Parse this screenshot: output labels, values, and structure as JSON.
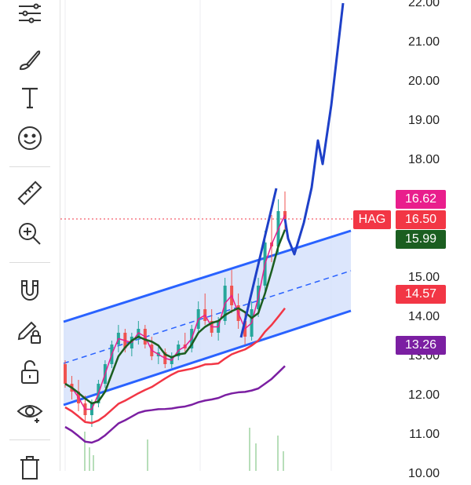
{
  "toolbar": {
    "tools": [
      {
        "name": "trendline-tools",
        "icon": "lines-icon"
      },
      {
        "name": "brush-tool",
        "icon": "brush-icon"
      },
      {
        "name": "text-tool",
        "icon": "text-icon"
      },
      {
        "name": "emoji-tool",
        "icon": "smiley-icon"
      },
      {
        "name": "ruler-tool",
        "icon": "ruler-icon"
      },
      {
        "name": "zoom-in-tool",
        "icon": "zoom-in-icon"
      },
      {
        "name": "magnet-tool",
        "icon": "magnet-icon"
      },
      {
        "name": "lock-drawings-tool",
        "icon": "pencil-lock-icon"
      },
      {
        "name": "lock-tool",
        "icon": "unlock-icon"
      },
      {
        "name": "hide-drawings-tool",
        "icon": "eye-icon"
      },
      {
        "name": "delete-tool",
        "icon": "trash-icon"
      }
    ]
  },
  "price_axis": {
    "labels": [
      "22.00",
      "21.00",
      "20.00",
      "19.00",
      "18.00",
      "15.00",
      "14.00",
      "13.00",
      "12.00",
      "11.00",
      "10.00"
    ]
  },
  "price_tags": {
    "symbol": "HAG",
    "tag_high": "16.62",
    "tag_last": "16.50",
    "tag_ma_fast": "15.99",
    "tag_ma_mid": "14.57",
    "tag_ma_slow": "13.26"
  },
  "colors": {
    "pink": "#e91e8c",
    "red": "#f23645",
    "green": "#1b5e20",
    "purple": "#7b1fa2",
    "channel_line": "#2962ff",
    "channel_fill": "#d6e2fb",
    "projection": "#1e40c8",
    "candle_up": "#26a69a",
    "candle_down": "#ef5350"
  },
  "chart_data": {
    "type": "candlestick",
    "ylim": [
      10.0,
      22.0
    ],
    "last_price": 16.5,
    "candles": [
      [
        12.8,
        12.9,
        12.2,
        12.3
      ],
      [
        12.3,
        12.5,
        11.9,
        12.1
      ],
      [
        12.1,
        12.4,
        11.6,
        11.8
      ],
      [
        11.8,
        12.0,
        11.3,
        11.5
      ],
      [
        11.5,
        11.9,
        11.2,
        11.8
      ],
      [
        11.8,
        12.4,
        11.7,
        12.3
      ],
      [
        12.3,
        12.9,
        12.2,
        12.8
      ],
      [
        12.8,
        13.4,
        12.7,
        13.3
      ],
      [
        13.3,
        13.8,
        13.1,
        13.6
      ],
      [
        13.6,
        13.7,
        13.1,
        13.2
      ],
      [
        13.2,
        13.6,
        13.0,
        13.5
      ],
      [
        13.5,
        13.9,
        13.3,
        13.7
      ],
      [
        13.7,
        13.8,
        13.2,
        13.3
      ],
      [
        13.3,
        13.5,
        12.9,
        13.0
      ],
      [
        13.0,
        13.3,
        12.8,
        13.1
      ],
      [
        13.1,
        13.2,
        12.7,
        12.8
      ],
      [
        12.8,
        13.1,
        12.7,
        13.0
      ],
      [
        13.0,
        13.4,
        12.9,
        13.3
      ],
      [
        13.3,
        13.6,
        13.1,
        13.2
      ],
      [
        13.2,
        13.8,
        13.1,
        13.7
      ],
      [
        13.7,
        14.4,
        13.6,
        14.2
      ],
      [
        14.2,
        14.6,
        13.8,
        13.9
      ],
      [
        13.9,
        14.2,
        13.5,
        13.6
      ],
      [
        13.6,
        14.0,
        13.4,
        13.9
      ],
      [
        13.9,
        15.0,
        13.8,
        14.8
      ],
      [
        14.8,
        15.2,
        14.1,
        14.3
      ],
      [
        14.3,
        14.6,
        13.7,
        13.9
      ],
      [
        13.9,
        14.1,
        13.3,
        13.5
      ],
      [
        13.5,
        14.4,
        13.4,
        14.2
      ],
      [
        14.2,
        15.0,
        14.0,
        14.8
      ],
      [
        14.8,
        16.2,
        14.6,
        15.9
      ],
      [
        15.9,
        16.6,
        15.4,
        15.8
      ],
      [
        15.8,
        17.0,
        15.6,
        16.7
      ],
      [
        16.7,
        17.2,
        16.2,
        16.5
      ]
    ],
    "projection": [
      16.5,
      16.0,
      15.6,
      16.4,
      17.3,
      18.5,
      17.9,
      19.4,
      22.0
    ]
  }
}
